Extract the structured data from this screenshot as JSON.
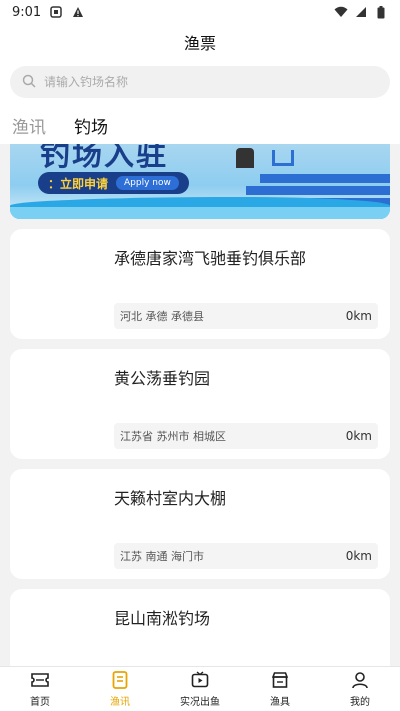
{
  "status": {
    "time": "9:01"
  },
  "header": {
    "title": "渔票"
  },
  "search": {
    "placeholder": "请输入钓场名称"
  },
  "tabs": [
    {
      "label": "渔讯",
      "active": false
    },
    {
      "label": "钓场",
      "active": true
    }
  ],
  "banner": {
    "headline": "钓场入驻",
    "cta_cn": "：立即申请",
    "cta_en": "Apply now"
  },
  "venues": [
    {
      "name": "承德唐家湾飞驰垂钓俱乐部",
      "location": "河北 承德 承德县",
      "distance": "0km"
    },
    {
      "name": "黄公荡垂钓园",
      "location": "江苏省 苏州市 相城区",
      "distance": "0km"
    },
    {
      "name": "天籁村室内大棚",
      "location": "江苏 南通 海门市",
      "distance": "0km"
    },
    {
      "name": "昆山南淞钓场",
      "location": "",
      "distance": ""
    }
  ],
  "nav": [
    {
      "label": "首页",
      "icon": "ticket-icon",
      "active": false
    },
    {
      "label": "渔讯",
      "icon": "news-icon",
      "active": true
    },
    {
      "label": "实况出鱼",
      "icon": "live-icon",
      "active": false
    },
    {
      "label": "渔具",
      "icon": "store-icon",
      "active": false
    },
    {
      "label": "我的",
      "icon": "user-icon",
      "active": false
    }
  ],
  "colors": {
    "accent": "#e8a400",
    "banner_blue": "#1a3f8a"
  }
}
